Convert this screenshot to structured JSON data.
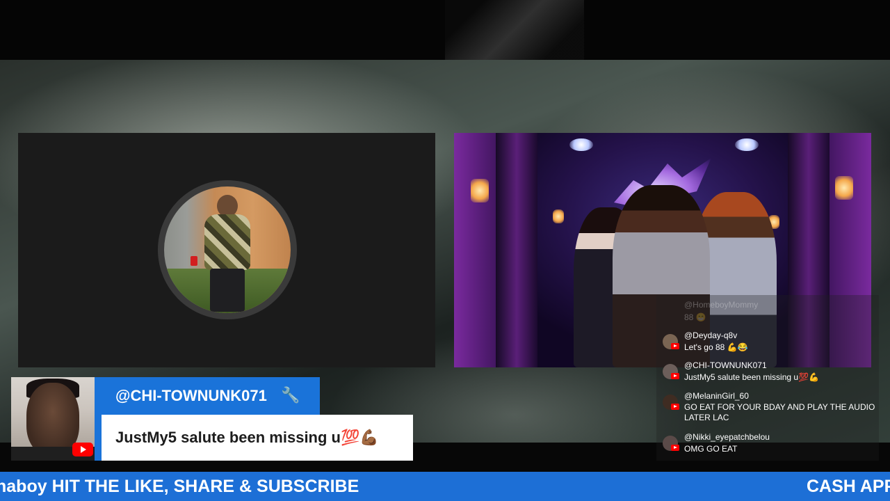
{
  "featured_comment": {
    "username": "@CHI-TOWNUNK071",
    "message": "JustMy5 salute been missing u💯💪🏾",
    "badge_icon": "wrench-icon",
    "platform_icon": "youtube-icon",
    "accent_color": "#1a73d9"
  },
  "chat": {
    "messages": [
      {
        "username": "@HomeboyMommy",
        "text": "88 😁"
      },
      {
        "username": "@Deyday-q8v",
        "text": "Let's go 88 💪😂"
      },
      {
        "username": "@CHI-TOWNUNK071",
        "text": "JustMy5 salute been missing u💯💪"
      },
      {
        "username": "@MelaninGirl_60",
        "text": "GO EAT FOR YOUR BDAY AND PLAY THE AUDIO LATER LAC"
      },
      {
        "username": "@Nikki_eyepatchbelou",
        "text": "OMG GO EAT"
      }
    ]
  },
  "ticker": {
    "segment_1": "haboy HIT THE LIKE, SHARE & SUBSCRIBE",
    "segment_2": "CASH APP",
    "color": "#1d6fd6"
  }
}
